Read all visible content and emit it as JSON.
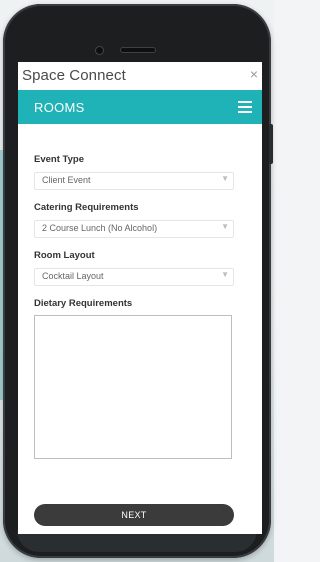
{
  "app": {
    "title": "Space Connect",
    "close_symbol": "×"
  },
  "header": {
    "title": "ROOMS",
    "menu_icon": "hamburger-menu-icon"
  },
  "form": {
    "event_type": {
      "label": "Event Type",
      "value": "Client Event"
    },
    "catering": {
      "label": "Catering Requirements",
      "value": "2 Course Lunch (No Alcohol)"
    },
    "room_layout": {
      "label": "Room Layout",
      "value": "Cocktail Layout"
    },
    "dietary": {
      "label": "Dietary Requirements",
      "value": ""
    }
  },
  "actions": {
    "next_label": "NEXT"
  },
  "colors": {
    "header_bg": "#1fb2b6",
    "button_bg": "#3b3b3b"
  }
}
